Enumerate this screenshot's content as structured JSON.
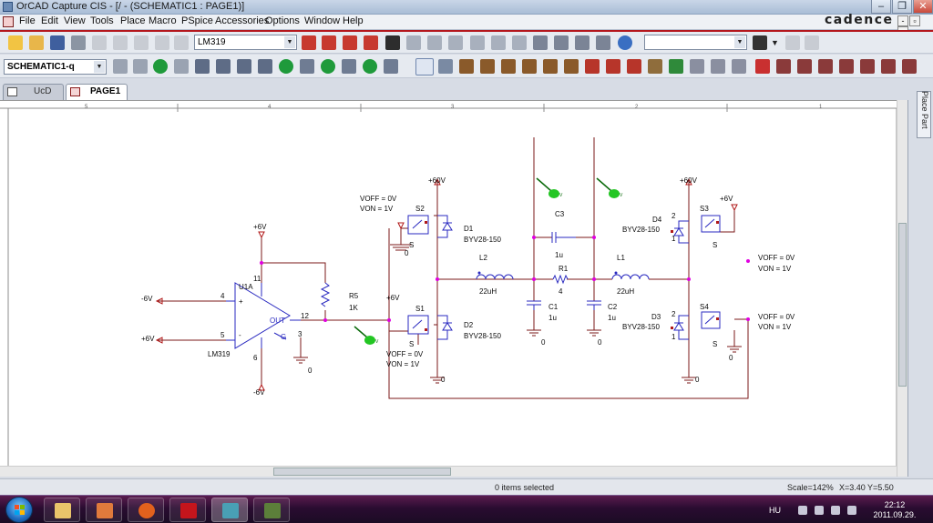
{
  "window": {
    "title": "OrCAD Capture CIS - [/ - (SCHEMATIC1 : PAGE1)]",
    "brand": "cadence",
    "caption_buttons": [
      "‒",
      "❐",
      "✕"
    ]
  },
  "menu": [
    "File",
    "Edit",
    "View",
    "Tools",
    "Place",
    "Macro",
    "PSpice",
    "Accessories",
    "Options",
    "Window",
    "Help"
  ],
  "toolbar": {
    "part_combo": "LM319",
    "search_combo": "",
    "schematic_combo": "SCHEMATIC1-q"
  },
  "tabs": [
    {
      "label": "UcD",
      "active": false
    },
    {
      "label": "PAGE1",
      "active": true
    }
  ],
  "side_panel": {
    "label": "Place Part"
  },
  "status": {
    "selection": "0 items selected",
    "scale": "Scale=142%",
    "x": "X=3.40",
    "y": "Y=5.50"
  },
  "taskbar": {
    "lang": "HU",
    "time": "22:12",
    "date": "2011.09.29."
  },
  "border_marks": {
    "top": [
      "5",
      "4",
      "3",
      "2",
      "1"
    ]
  },
  "schematic": {
    "u1": {
      "ref": "U1A",
      "part": "LM319",
      "pins": [
        "4",
        "5",
        "11",
        "6",
        "12",
        "3"
      ],
      "pin_signs": [
        "+",
        "-"
      ],
      "output_label": "OUT",
      "gnd_label": "G",
      "vminus_left": "-6V",
      "vplus_left": "+6V",
      "vplus_top": "+6V",
      "vminus_bottom": "-6V",
      "gnd_value": "0"
    },
    "r5": {
      "ref": "R5",
      "value": "1K"
    },
    "s2": {
      "ref": "S2",
      "voff": "VOFF = 0V",
      "von": "VON = 1V",
      "s": "S",
      "gnd": "0",
      "supply": "+60V"
    },
    "s1": {
      "ref": "S1",
      "voff": "VOFF = 0V",
      "von": "VON = 1V",
      "s": "S",
      "supply": "+6V"
    },
    "d1": {
      "ref": "D1",
      "part": "BYV28-150"
    },
    "d2": {
      "ref": "D2",
      "part": "BYV28-150"
    },
    "l2": {
      "ref": "L2",
      "value": "22uH"
    },
    "l1": {
      "ref": "L1",
      "value": "22uH"
    },
    "c3": {
      "ref": "C3",
      "value": "1u"
    },
    "r1": {
      "ref": "R1",
      "value": "4"
    },
    "c1": {
      "ref": "C1",
      "value": "1u"
    },
    "c2": {
      "ref": "C2",
      "value": "1u"
    },
    "s3": {
      "ref": "S3",
      "s": "S",
      "supply": "+60V",
      "supply2": "+6V",
      "voff": "VOFF = 0V",
      "von": "VON = 1V"
    },
    "s4": {
      "ref": "S4",
      "s": "S",
      "voff": "VOFF = 0V",
      "von": "VON = 1V"
    },
    "d4": {
      "ref": "D4",
      "part": "BYV28-150",
      "pins": [
        "2",
        "1"
      ]
    },
    "d3": {
      "ref": "D3",
      "part": "BYV28-150",
      "pins": [
        "2",
        "1"
      ]
    },
    "grounds": [
      "0",
      "0",
      "0",
      "0",
      "0",
      "0"
    ]
  },
  "colors": {
    "wire": "#7b1a1a",
    "part": "#2a2ac0",
    "text": "#0b0b0b",
    "junction": "#e000e0",
    "probe": "#23c623",
    "accent": "#b4161c"
  }
}
